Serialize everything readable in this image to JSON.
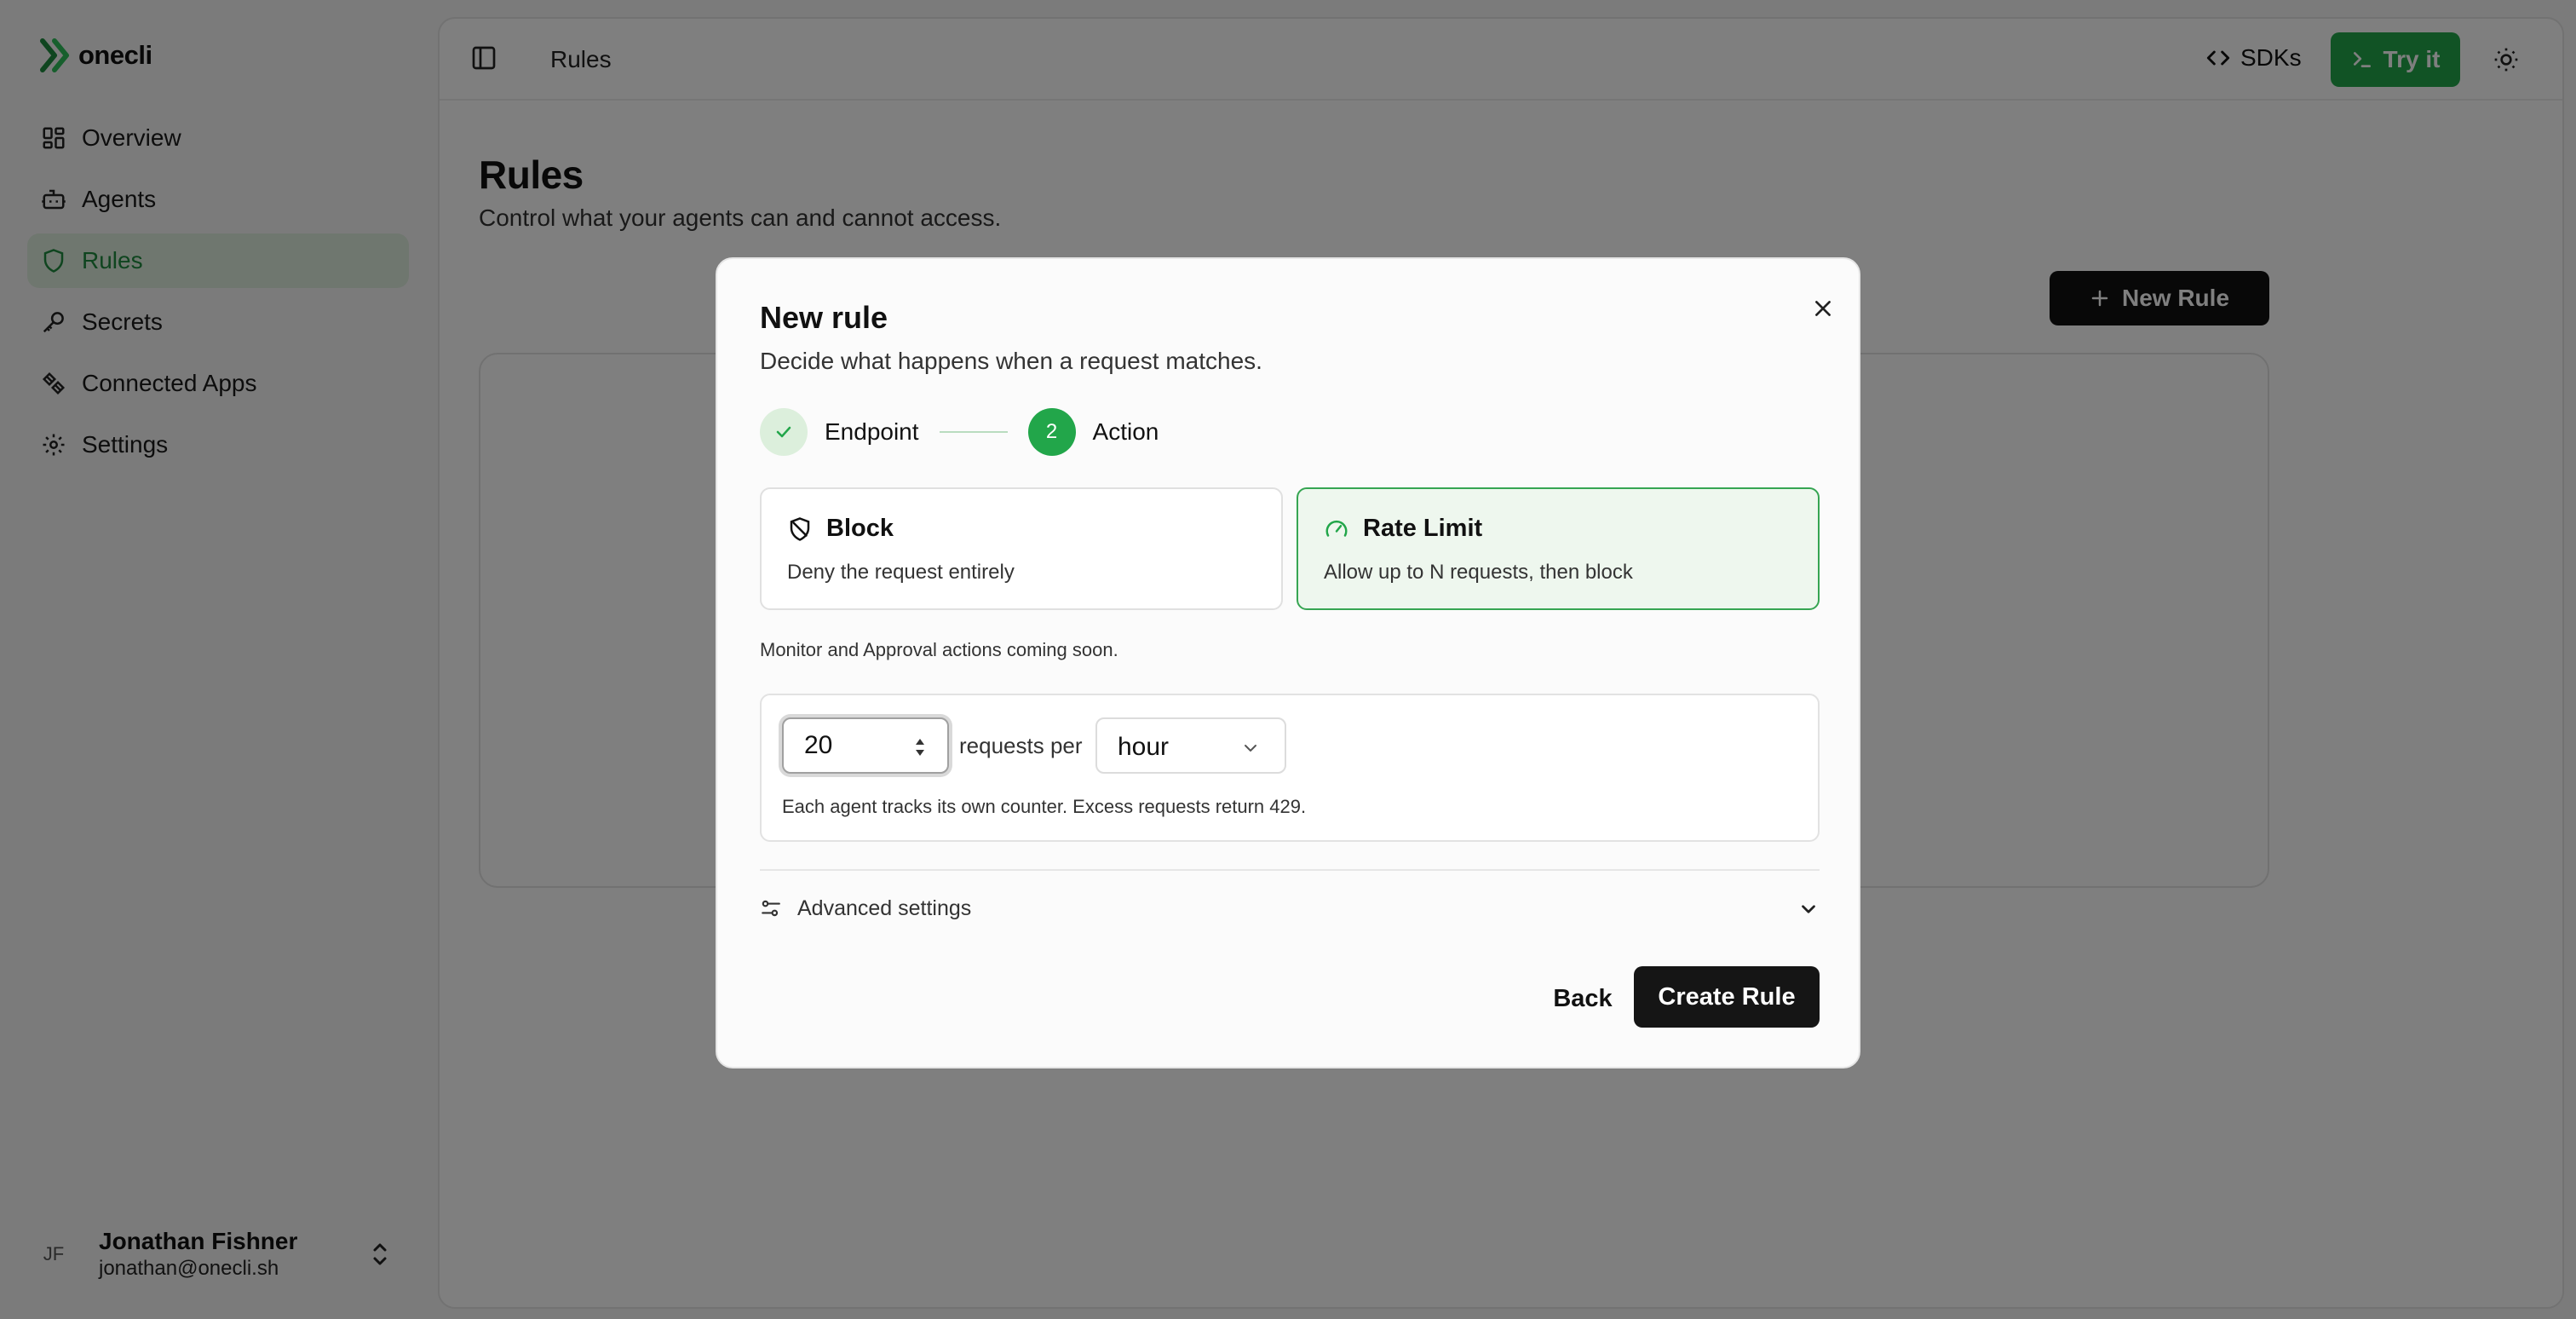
{
  "brand": {
    "name": "onecli"
  },
  "sidebar": {
    "items": [
      {
        "label": "Overview",
        "icon": "layout-grid-icon",
        "active": false
      },
      {
        "label": "Agents",
        "icon": "bot-icon",
        "active": false
      },
      {
        "label": "Rules",
        "icon": "shield-icon",
        "active": true
      },
      {
        "label": "Secrets",
        "icon": "key-icon",
        "active": false
      },
      {
        "label": "Connected Apps",
        "icon": "plug-icon",
        "active": false
      },
      {
        "label": "Settings",
        "icon": "gear-icon",
        "active": false
      }
    ],
    "user": {
      "initials": "JF",
      "name": "Jonathan Fishner",
      "email": "jonathan@onecli.sh"
    }
  },
  "topbar": {
    "breadcrumb": "Rules",
    "sdks_label": "SDKs",
    "try_label": "Try it"
  },
  "page": {
    "title": "Rules",
    "subtitle": "Control what your agents can and cannot access.",
    "new_rule_label": "New Rule"
  },
  "modal": {
    "title": "New rule",
    "subtitle": "Decide what happens when a request matches.",
    "steps": [
      {
        "label": "Endpoint",
        "state": "done"
      },
      {
        "label": "Action",
        "number": "2",
        "state": "current"
      }
    ],
    "options": [
      {
        "title": "Block",
        "description": "Deny the request entirely",
        "selected": false
      },
      {
        "title": "Rate Limit",
        "description": "Allow up to N requests, then block",
        "selected": true
      }
    ],
    "coming_soon": "Monitor and Approval actions coming soon.",
    "rate": {
      "value": "20",
      "unit_label": "requests per",
      "period": "hour",
      "note": "Each agent tracks its own counter. Excess requests return 429."
    },
    "advanced_label": "Advanced settings",
    "back_label": "Back",
    "create_label": "Create Rule"
  },
  "colors": {
    "accent": "#22a64a",
    "active_nav_bg": "#dfeede",
    "selected_card_bg": "#eef7ee",
    "dark_button": "#151515"
  }
}
